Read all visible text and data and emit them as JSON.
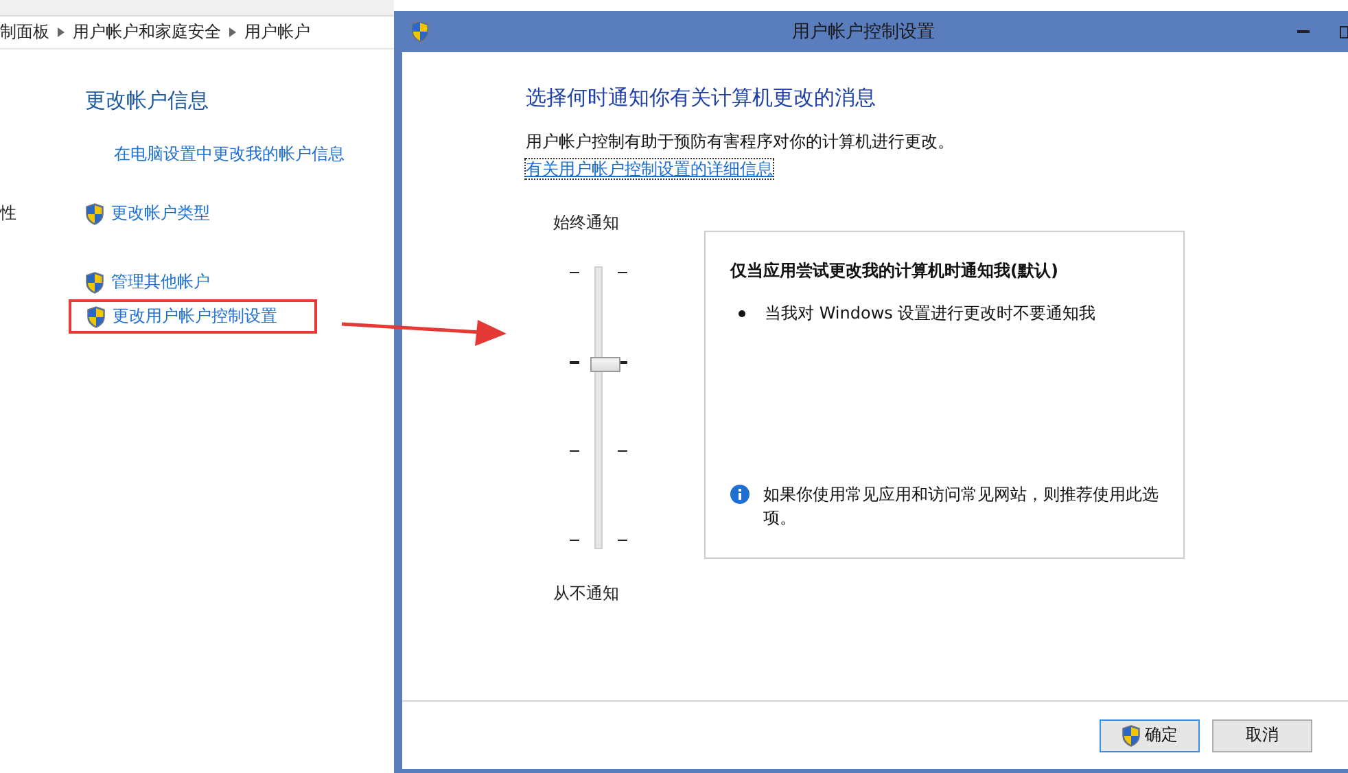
{
  "background_window": {
    "breadcrumb": [
      "制面板",
      "用户帐户和家庭安全",
      "用户帐户"
    ],
    "heading": "更改帐户信息",
    "settings_link": "在电脑设置中更改我的帐户信息",
    "side_text": "性",
    "link_groups": [
      [
        {
          "label": "更改帐户类型",
          "highlighted": false
        }
      ],
      [
        {
          "label": "管理其他帐户",
          "highlighted": false
        },
        {
          "label": "更改用户帐户控制设置",
          "highlighted": true
        }
      ]
    ]
  },
  "dialog": {
    "title": "用户帐户控制设置",
    "heading": "选择何时通知你有关计算机更改的消息",
    "description": "用户帐户控制有助于预防有害程序对你的计算机进行更改。",
    "details_link": "有关用户帐户控制设置的详细信息",
    "slider": {
      "top_label": "始终通知",
      "bottom_label": "从不通知",
      "level": 0.667
    },
    "card": {
      "title": "仅当应用尝试更改我的计算机时通知我(默认)",
      "bullets": [
        "当我对 Windows 设置进行更改时不要通知我"
      ],
      "note": "如果你使用常见应用和访问常见网站，则推荐使用此选项。"
    },
    "buttons": [
      {
        "label": "确定",
        "shield": true,
        "focused": true
      },
      {
        "label": "取消",
        "shield": false,
        "focused": false
      }
    ]
  }
}
